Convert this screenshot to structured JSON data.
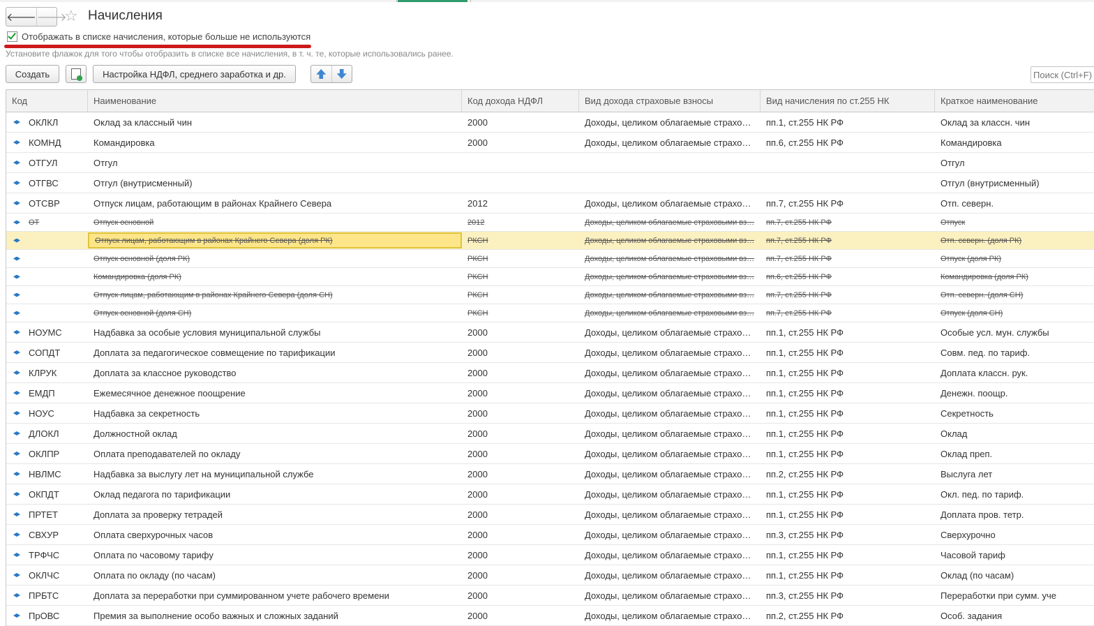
{
  "window": {
    "title": "Начисления"
  },
  "nav": {
    "back": "🡐",
    "forward": "🡒"
  },
  "filter": {
    "checkbox_label": "Отображать в списке начисления, которые больше не используются",
    "checked": true,
    "hint": "Установите флажок для того чтобы отобразить в списке все начисления, в т. ч. те, которые использовались ранее."
  },
  "toolbar": {
    "create_label": "Создать",
    "ndfl_label": "Настройка НДФЛ, среднего заработка и др.",
    "search_placeholder": "Поиск (Ctrl+F)"
  },
  "columns": [
    "Код",
    "Наименование",
    "Код дохода НДФЛ",
    "Вид дохода страховые взносы",
    "Вид начисления по ст.255 НК",
    "Краткое наименование"
  ],
  "rows": [
    {
      "code": "ОКЛКЛ",
      "name": "Оклад за классный чин",
      "ndfl": "2000",
      "ins": "Доходы, целиком облагаемые страхо…",
      "nk": "пп.1, ст.255 НК РФ",
      "short": "Оклад за классн. чин",
      "state": "normal"
    },
    {
      "code": "КОМНД",
      "name": "Командировка",
      "ndfl": "2000",
      "ins": "Доходы, целиком облагаемые страхо…",
      "nk": "пп.6, ст.255 НК РФ",
      "short": "Командировка",
      "state": "normal"
    },
    {
      "code": "ОТГУЛ",
      "name": "Отгул",
      "ndfl": "",
      "ins": "",
      "nk": "",
      "short": "Отгул",
      "state": "normal"
    },
    {
      "code": "ОТГВС",
      "name": "Отгул (внутрисменный)",
      "ndfl": "",
      "ins": "",
      "nk": "",
      "short": "Отгул (внутрисменный)",
      "state": "normal"
    },
    {
      "code": "ОТСВР",
      "name": "Отпуск лицам, работающим в районах Крайнего Севера",
      "ndfl": "2012",
      "ins": "Доходы, целиком облагаемые страхо…",
      "nk": "пп.7, ст.255 НК РФ",
      "short": "Отп. северн.",
      "state": "normal"
    },
    {
      "code": "ОТ",
      "name": "Отпуск основной",
      "ndfl": "2012",
      "ins": "Доходы, целиком облагаемые страховыми вз…",
      "nk": "пп.7, ст.255 НК РФ",
      "short": "Отпуск",
      "state": "unused"
    },
    {
      "code": "",
      "name": "Отпуск лицам, работающим в районах Крайнего Севера (доля РК)",
      "ndfl": "РКСН",
      "ins": "Доходы, целиком облагаемые страховыми вз…",
      "nk": "пп.7, ст.255 НК РФ",
      "short": "Отп. северн. (доля РК)",
      "state": "selected"
    },
    {
      "code": "",
      "name": "Отпуск основной (доля РК)",
      "ndfl": "РКСН",
      "ins": "Доходы, целиком облагаемые страховыми вз…",
      "nk": "пп.7, ст.255 НК РФ",
      "short": "Отпуск (доля РК)",
      "state": "unused"
    },
    {
      "code": "",
      "name": "Командировка (доля РК)",
      "ndfl": "РКСН",
      "ins": "Доходы, целиком облагаемые страховыми вз…",
      "nk": "пп.6, ст.255 НК РФ",
      "short": "Командировка (доля РК)",
      "state": "unused"
    },
    {
      "code": "",
      "name": "Отпуск лицам, работающим в районах Крайнего Севера (доля СН)",
      "ndfl": "РКСН",
      "ins": "Доходы, целиком облагаемые страховыми вз…",
      "nk": "пп.7, ст.255 НК РФ",
      "short": "Отп. северн. (доля СН)",
      "state": "unused"
    },
    {
      "code": "",
      "name": "Отпуск основной (доля СН)",
      "ndfl": "РКСН",
      "ins": "Доходы, целиком облагаемые страховыми вз…",
      "nk": "пп.7, ст.255 НК РФ",
      "short": "Отпуск (доля СН)",
      "state": "unused"
    },
    {
      "code": "НОУМС",
      "name": "Надбавка за особые условия муниципальной службы",
      "ndfl": "2000",
      "ins": "Доходы, целиком облагаемые страхо…",
      "nk": "пп.1, ст.255 НК РФ",
      "short": "Особые усл. мун. службы",
      "state": "normal"
    },
    {
      "code": "СОПДТ",
      "name": "Доплата за педагогическое совмещение по тарификации",
      "ndfl": "2000",
      "ins": "Доходы, целиком облагаемые страхо…",
      "nk": "пп.1, ст.255 НК РФ",
      "short": "Совм. пед. по тариф.",
      "state": "normal"
    },
    {
      "code": "КЛРУК",
      "name": "Доплата за классное руководство",
      "ndfl": "2000",
      "ins": "Доходы, целиком облагаемые страхо…",
      "nk": "пп.1, ст.255 НК РФ",
      "short": "Доплата классн. рук.",
      "state": "normal"
    },
    {
      "code": "ЕМДП",
      "name": "Ежемесячное денежное поощрение",
      "ndfl": "2000",
      "ins": "Доходы, целиком облагаемые страхо…",
      "nk": "пп.1, ст.255 НК РФ",
      "short": "Денежн. поощр.",
      "state": "normal"
    },
    {
      "code": "НОУС",
      "name": "Надбавка за секретность",
      "ndfl": "2000",
      "ins": "Доходы, целиком облагаемые страхо…",
      "nk": "пп.1, ст.255 НК РФ",
      "short": "Секретность",
      "state": "normal"
    },
    {
      "code": "ДЛОКЛ",
      "name": "Должностной оклад",
      "ndfl": "2000",
      "ins": "Доходы, целиком облагаемые страхо…",
      "nk": "пп.1, ст.255 НК РФ",
      "short": "Оклад",
      "state": "normal"
    },
    {
      "code": "ОКЛПР",
      "name": "Оплата преподавателей по окладу",
      "ndfl": "2000",
      "ins": "Доходы, целиком облагаемые страхо…",
      "nk": "пп.1, ст.255 НК РФ",
      "short": "Оклад преп.",
      "state": "normal"
    },
    {
      "code": "НВЛМС",
      "name": "Надбавка за выслугу лет на муниципальной службе",
      "ndfl": "2000",
      "ins": "Доходы, целиком облагаемые страхо…",
      "nk": "пп.2, ст.255 НК РФ",
      "short": "Выслуга лет",
      "state": "normal"
    },
    {
      "code": "ОКПДТ",
      "name": "Оклад педагога по тарификации",
      "ndfl": "2000",
      "ins": "Доходы, целиком облагаемые страхо…",
      "nk": "пп.1, ст.255 НК РФ",
      "short": "Окл. пед. по тариф.",
      "state": "normal"
    },
    {
      "code": "ПРТЕТ",
      "name": "Доплата за проверку тетрадей",
      "ndfl": "2000",
      "ins": "Доходы, целиком облагаемые страхо…",
      "nk": "пп.1, ст.255 НК РФ",
      "short": "Доплата пров. тетр.",
      "state": "normal"
    },
    {
      "code": "СВХУР",
      "name": "Оплата сверхурочных часов",
      "ndfl": "2000",
      "ins": "Доходы, целиком облагаемые страхо…",
      "nk": "пп.3, ст.255 НК РФ",
      "short": "Сверхурочно",
      "state": "normal"
    },
    {
      "code": "ТРФЧС",
      "name": "Оплата по часовому тарифу",
      "ndfl": "2000",
      "ins": "Доходы, целиком облагаемые страхо…",
      "nk": "пп.1, ст.255 НК РФ",
      "short": "Часовой тариф",
      "state": "normal"
    },
    {
      "code": "ОКЛЧС",
      "name": "Оплата по окладу (по часам)",
      "ndfl": "2000",
      "ins": "Доходы, целиком облагаемые страхо…",
      "nk": "пп.1, ст.255 НК РФ",
      "short": "Оклад (по часам)",
      "state": "normal"
    },
    {
      "code": "ПРБТС",
      "name": "Доплата за переработки при суммированном учете рабочего времени",
      "ndfl": "2000",
      "ins": "Доходы, целиком облагаемые страхо…",
      "nk": "пп.3, ст.255 НК РФ",
      "short": "Переработки при сумм. уче",
      "state": "normal"
    },
    {
      "code": "ПрОВС",
      "name": "Премия за выполнение особо важных и сложных заданий",
      "ndfl": "2000",
      "ins": "Доходы, целиком облагаемые страхо…",
      "nk": "пп.2, ст.255 НК РФ",
      "short": "Особ. задания",
      "state": "normal"
    }
  ]
}
